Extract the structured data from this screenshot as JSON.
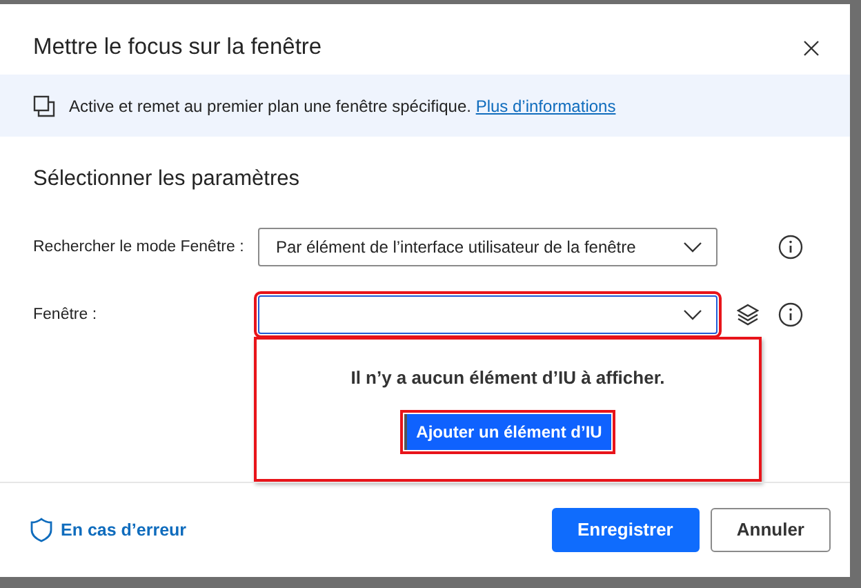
{
  "dialog": {
    "title": "Mettre le focus sur la fenêtre"
  },
  "banner": {
    "text": "Active et remet au premier plan une fenêtre spécifique.",
    "link": "Plus d’informations"
  },
  "section_title": "Sélectionner les paramètres",
  "fields": [
    {
      "label": "Rechercher le mode Fenêtre :",
      "value": "Par élément de l’interface utilisateur de la fenêtre",
      "highlighted": false,
      "layers": false
    },
    {
      "label": "Fenêtre :",
      "highlighted": true,
      "layers": true
    }
  ],
  "popup": {
    "message": "Il n’y a aucun élément d’IU à afficher.",
    "button": "Ajouter un élément d’IU",
    "highlighted": true
  },
  "footer": {
    "error_link": "En cas d’erreur",
    "buttons": [
      {
        "label": "Enregistrer",
        "kind": "primary"
      },
      {
        "label": "Annuler",
        "kind": "secondary"
      }
    ]
  }
}
